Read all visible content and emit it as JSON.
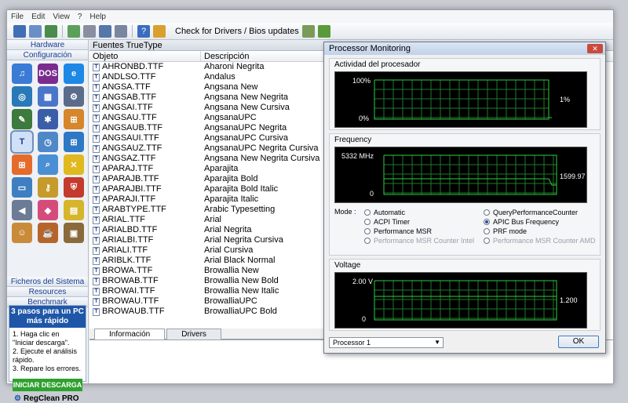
{
  "menu": [
    "File",
    "Edit",
    "View",
    "?",
    "Help"
  ],
  "toolbar": {
    "check_label": "Check for Drivers / Bios updates"
  },
  "leftpanel": {
    "hardware": "Hardware",
    "configuracion": "Configuración",
    "ficheros": "Ficheros del Sistema",
    "recursos": "Resources",
    "benchmark": "Benchmark",
    "icons": [
      {
        "name": "midi-icon",
        "label": "♫",
        "color": "#3a7bd5"
      },
      {
        "name": "dos-icon",
        "label": "DOS",
        "color": "#7a2b8f"
      },
      {
        "name": "ie-icon",
        "label": "e",
        "color": "#1e88e5"
      },
      {
        "name": "globe-icon",
        "label": "◎",
        "color": "#2979b8"
      },
      {
        "name": "blocks-icon",
        "label": "▦",
        "color": "#4a76c9"
      },
      {
        "name": "gear-icon",
        "label": "⚙",
        "color": "#5b6b8a"
      },
      {
        "name": "pencil-icon",
        "label": "✎",
        "color": "#3d7a3d"
      },
      {
        "name": "molecule-icon",
        "label": "✱",
        "color": "#3b5ea8"
      },
      {
        "name": "windows-flag-icon",
        "label": "⊞",
        "color": "#d6862b"
      },
      {
        "name": "font-icon",
        "label": "T",
        "color": "#1b3f8a",
        "selected": true
      },
      {
        "name": "clock-icon",
        "label": "◷",
        "color": "#4f88c6"
      },
      {
        "name": "windows-update-icon",
        "label": "⊞",
        "color": "#2f78c4"
      },
      {
        "name": "windows-logo-icon",
        "label": "⊞",
        "color": "#e56b2c"
      },
      {
        "name": "search-icon",
        "label": "⌕",
        "color": "#4a8fd4"
      },
      {
        "name": "remove-icon",
        "label": "✕",
        "color": "#e0b91e"
      },
      {
        "name": "window-icon",
        "label": "▭",
        "color": "#3f7fc1"
      },
      {
        "name": "key-icon",
        "label": "⚷",
        "color": "#c69a2b"
      },
      {
        "name": "shield-icon",
        "label": "⛨",
        "color": "#c33b2c"
      },
      {
        "name": "speaker-icon",
        "label": "◀",
        "color": "#6b7c94"
      },
      {
        "name": "colors-icon",
        "label": "◆",
        "color": "#d54b7a"
      },
      {
        "name": "display-icon",
        "label": "▤",
        "color": "#d6b52b"
      },
      {
        "name": "user-icon",
        "label": "☺",
        "color": "#c98b3a"
      },
      {
        "name": "java-icon",
        "label": "☕",
        "color": "#b5652b"
      },
      {
        "name": "box-icon",
        "label": "▣",
        "color": "#8a6a3a"
      }
    ],
    "promo": {
      "title": "3 pasos para un PC más rápido",
      "steps": [
        "1. Haga clic en \"Iniciar descarga\".",
        "2. Ejecute el análisis rápido.",
        "3. Repare los errores."
      ],
      "button": "INICIAR DESCARGA",
      "logo": "RegClean PRO"
    }
  },
  "main": {
    "title": "Fuentes TrueType",
    "col_objeto": "Objeto",
    "col_descripcion": "Descripción",
    "rows": [
      {
        "objeto": "AHRONBD.TTF",
        "descripcion": "Aharoni Negrita"
      },
      {
        "objeto": "ANDLSO.TTF",
        "descripcion": "Andalus"
      },
      {
        "objeto": "ANGSA.TTF",
        "descripcion": "Angsana New"
      },
      {
        "objeto": "ANGSAB.TTF",
        "descripcion": "Angsana New Negrita"
      },
      {
        "objeto": "ANGSAI.TTF",
        "descripcion": "Angsana New Cursiva"
      },
      {
        "objeto": "ANGSAU.TTF",
        "descripcion": "AngsanaUPC"
      },
      {
        "objeto": "ANGSAUB.TTF",
        "descripcion": "AngsanaUPC Negrita"
      },
      {
        "objeto": "ANGSAUI.TTF",
        "descripcion": "AngsanaUPC Cursiva"
      },
      {
        "objeto": "ANGSAUZ.TTF",
        "descripcion": "AngsanaUPC Negrita Cursiva"
      },
      {
        "objeto": "ANGSAZ.TTF",
        "descripcion": "Angsana New Negrita Cursiva"
      },
      {
        "objeto": "APARAJ.TTF",
        "descripcion": "Aparajita"
      },
      {
        "objeto": "APARAJB.TTF",
        "descripcion": "Aparajita Bold"
      },
      {
        "objeto": "APARAJBI.TTF",
        "descripcion": "Aparajita Bold Italic"
      },
      {
        "objeto": "APARAJI.TTF",
        "descripcion": "Aparajita Italic"
      },
      {
        "objeto": "ARABTYPE.TTF",
        "descripcion": "Arabic Typesetting"
      },
      {
        "objeto": "ARIAL.TTF",
        "descripcion": "Arial"
      },
      {
        "objeto": "ARIALBD.TTF",
        "descripcion": "Arial Negrita"
      },
      {
        "objeto": "ARIALBI.TTF",
        "descripcion": "Arial Negrita Cursiva"
      },
      {
        "objeto": "ARIALI.TTF",
        "descripcion": "Arial Cursiva"
      },
      {
        "objeto": "ARIBLK.TTF",
        "descripcion": "Arial Black Normal"
      },
      {
        "objeto": "BROWA.TTF",
        "descripcion": "Browallia New"
      },
      {
        "objeto": "BROWAB.TTF",
        "descripcion": "Browallia New Bold"
      },
      {
        "objeto": "BROWAI.TTF",
        "descripcion": "Browallia New Italic"
      },
      {
        "objeto": "BROWAU.TTF",
        "descripcion": "BrowalliaUPC"
      },
      {
        "objeto": "BROWAUB.TTF",
        "descripcion": "BrowalliaUPC Bold"
      }
    ],
    "tabs": [
      "Información",
      "Drivers"
    ]
  },
  "dialog": {
    "title": "Processor Monitoring",
    "close": "✕",
    "activity": {
      "label": "Actividad del procesador",
      "top": "100%",
      "bottom": "0%",
      "current": "1%"
    },
    "frequency": {
      "label": "Frequency",
      "top": "5332 MHz",
      "bottom": "0",
      "current": "1599.97"
    },
    "mode_label": "Mode :",
    "modes_left": [
      {
        "label": "Automatic",
        "checked": false,
        "disabled": false
      },
      {
        "label": "ACPI Timer",
        "checked": false,
        "disabled": false
      },
      {
        "label": "Performance MSR",
        "checked": false,
        "disabled": false
      },
      {
        "label": "Performance MSR Counter Intel",
        "checked": false,
        "disabled": true
      }
    ],
    "modes_right": [
      {
        "label": "QueryPerformanceCounter",
        "checked": false,
        "disabled": false
      },
      {
        "label": "APIC Bus Frequency",
        "checked": true,
        "disabled": false
      },
      {
        "label": "PRF mode",
        "checked": false,
        "disabled": false
      },
      {
        "label": "Performance MSR Counter AMD",
        "checked": false,
        "disabled": true
      }
    ],
    "voltage": {
      "label": "Voltage",
      "top": "2.00 V",
      "bottom": "0",
      "current": "1.200"
    },
    "processor_select": "Processor 1",
    "ok": "OK"
  },
  "colors": {
    "graph_line": "#2ecc40",
    "graph_grid": "#1e7a2a",
    "accent": "#1f57a8"
  }
}
